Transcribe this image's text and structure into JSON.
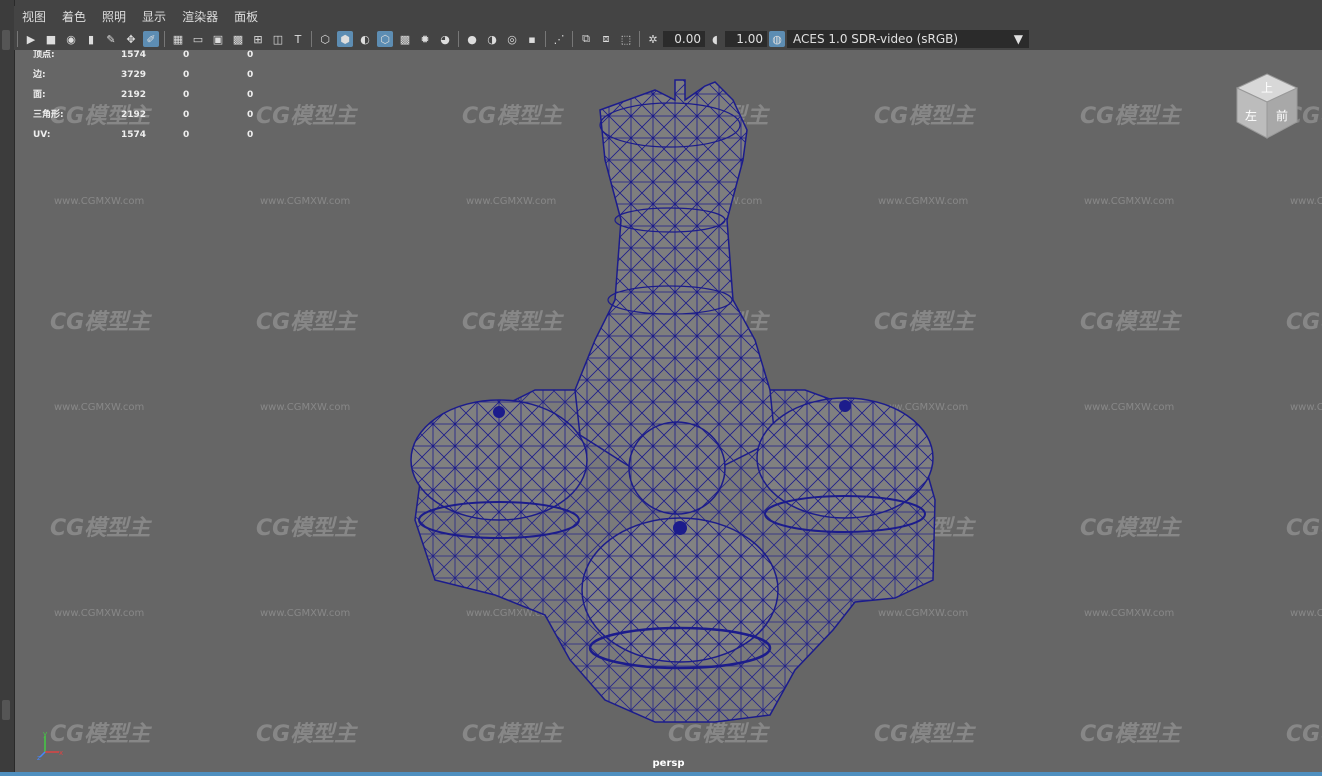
{
  "menu": [
    "视图",
    "着色",
    "照明",
    "显示",
    "渲染器",
    "面板"
  ],
  "toolbar": {
    "exposure_value": "0.00",
    "gamma_value": "1.00",
    "color_space": "ACES 1.0 SDR-video (sRGB)"
  },
  "hud": {
    "rows": [
      {
        "label": "顶点:",
        "v1": "1574",
        "v2": "0",
        "v3": "0"
      },
      {
        "label": "边:",
        "v1": "3729",
        "v2": "0",
        "v3": "0"
      },
      {
        "label": "面:",
        "v1": "2192",
        "v2": "0",
        "v3": "0"
      },
      {
        "label": "三角形:",
        "v1": "2192",
        "v2": "0",
        "v3": "0"
      },
      {
        "label": "UV:",
        "v1": "1574",
        "v2": "0",
        "v3": "0"
      }
    ]
  },
  "viewport": {
    "camera": "persp",
    "viewcube_top": "上",
    "viewcube_left": "左",
    "viewcube_front": "前",
    "axis_x": "x",
    "axis_y": "y",
    "axis_z": "z"
  },
  "watermark": {
    "logo": "CG模型主",
    "url": "www.CGMXW.com"
  },
  "colors": {
    "viewport_bg": "#666666",
    "wire": "#1c1c8c",
    "accent": "#5d8db3"
  }
}
